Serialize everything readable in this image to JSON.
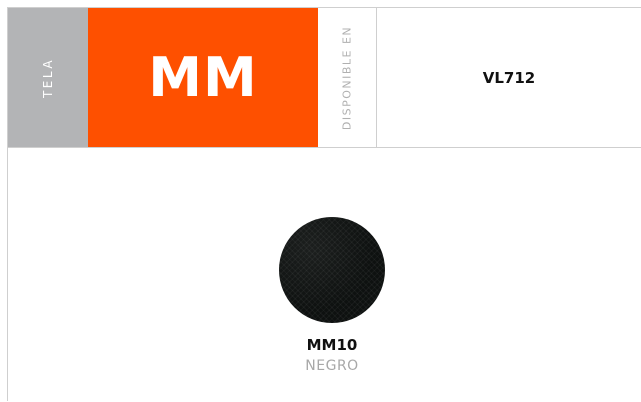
{
  "header": {
    "category_label": "TELA",
    "fabric_code": "MM",
    "available_label": "DISPONIBLE EN",
    "model_code": "VL712"
  },
  "swatch": {
    "code": "MM10",
    "color_name": "NEGRO",
    "fill_color": "#0e1110"
  },
  "colors": {
    "accent": "#fe5000",
    "category_bg": "#b3b4b6",
    "muted_text": "#a8a8a8",
    "border": "#cfcfcf"
  }
}
